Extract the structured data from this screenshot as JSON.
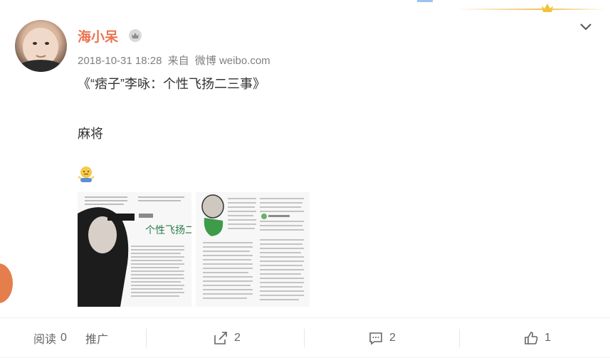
{
  "post": {
    "username": "海小呆",
    "time": "2018-10-31 18:28",
    "from_label": "来自",
    "source": "微博 weibo.com",
    "title": "《“痞子”李咏：个性飞扬二三事》",
    "body": "麻将"
  },
  "actions": {
    "read_label": "阅读",
    "read_count": "0",
    "promote_label": "推广",
    "forward_count": "2",
    "comment_count": "2",
    "like_count": "1"
  },
  "icons": {
    "vip": "crown-badge-icon",
    "menu": "chevron-down-icon",
    "emoji": "shrug-emoji-icon",
    "forward": "forward-icon",
    "comment": "comment-icon",
    "like": "thumbs-up-icon"
  },
  "colors": {
    "username": "#eb7350",
    "meta": "#808080",
    "text": "#333333"
  }
}
